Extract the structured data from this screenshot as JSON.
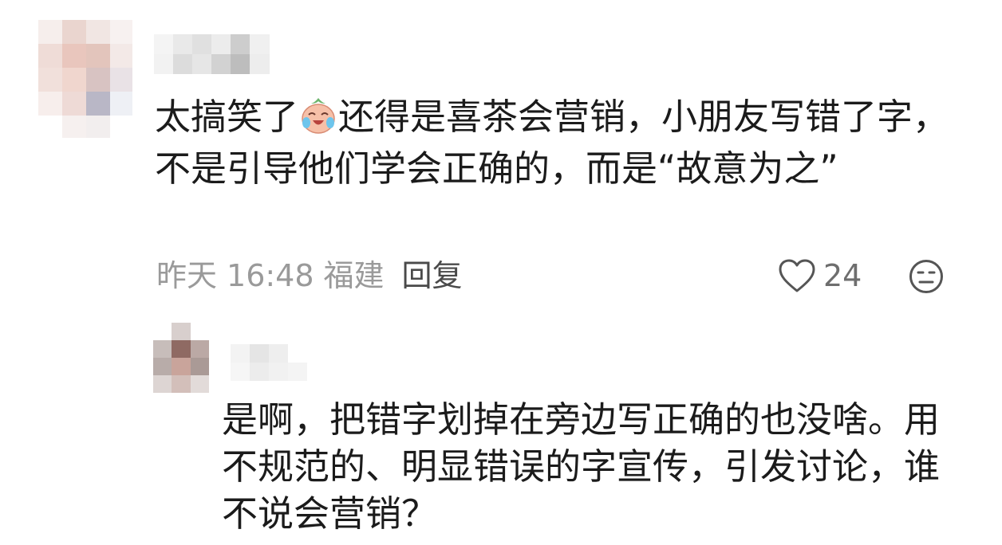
{
  "comment": {
    "text_before_emoji": "太搞笑了",
    "emoji_icon": "crying-laughing-peach-emoji",
    "text_after_emoji": "还得是喜茶会营销，小朋友写错了字，不是引导他们学会正确的，而是“故意为之”",
    "date": "昨天",
    "time": "16:48",
    "location": "福建",
    "reply_label": "回复",
    "like_count": "24",
    "icons": {
      "like": "heart-outline-icon",
      "dislike": "neutral-face-icon"
    }
  },
  "reply": {
    "text": "是啊，把错字划掉在旁边写正确的也没啥。用不规范的、明显错误的字宣传，引发讨论，谁不说会营销？"
  },
  "colors": {
    "text": "#1b1b1b",
    "meta": "#9a9a9a",
    "icon": "#555555"
  }
}
